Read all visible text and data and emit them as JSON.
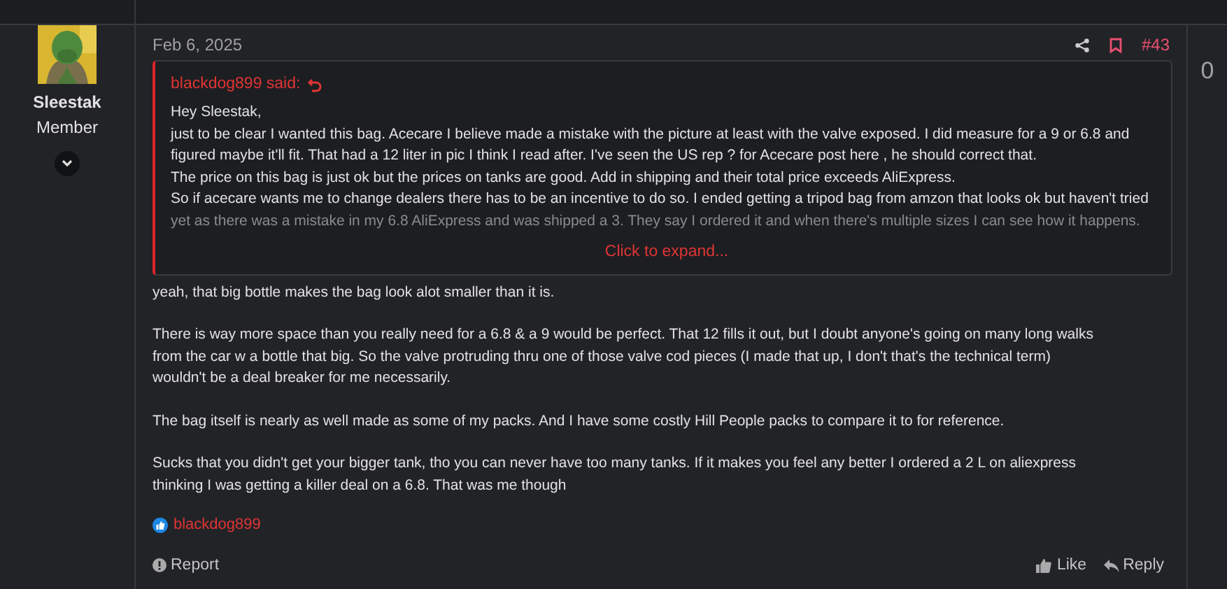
{
  "author": {
    "name": "Sleestak",
    "role": "Member"
  },
  "post": {
    "date": "Feb 6, 2025",
    "number": "#43",
    "bookmarked": false
  },
  "quote": {
    "attribution": "blackdog899 said:",
    "collapsed": true,
    "lines": [
      "Hey Sleestak,",
      "just to be clear I wanted this bag. Acecare I believe made a mistake with the picture at least with the valve exposed. I did measure for a 9 or 6.8 and",
      "figured maybe it'll fit. That had a 12 liter in pic I think I read after. I've seen the US rep ? for Acecare post here , he should correct that.",
      "The price on this bag is just ok but the prices on tanks are good. Add in shipping and their total price exceeds AliExpress.",
      "So if acecare wants me to change dealers there has to be an incentive to do so. I ended getting a tripod bag from amzon that looks ok but haven't tried",
      "yet as there was a mistake in my 6.8 AliExpress and was shipped a 3. They say I ordered it and when there's multiple sizes I can see how it happens."
    ],
    "expand": "Click to expand..."
  },
  "paragraphs": [
    [
      "yeah, that big bottle makes the bag look alot smaller than it is."
    ],
    [
      "There is way more space than you really need for a 6.8 & a 9 would be perfect. That 12 fills it out, but I doubt anyone's going on many long walks",
      "from the car w a bottle that big. So the valve protruding thru one of those valve cod pieces (I made that up, I don't that's the technical term)",
      "wouldn't be a deal breaker for me necessarily."
    ],
    [
      "The bag itself is nearly as well made as some of my packs. And I have some costly Hill People packs to compare it to for reference."
    ],
    [
      "Sucks that you didn't get your bigger tank, tho you can never have too many tanks. If it makes you feel any better I ordered a 2 L on aliexpress",
      "thinking I was getting a killer deal on a 6.8. That was me though"
    ]
  ],
  "reactions": {
    "users": "blackdog899"
  },
  "actions": {
    "report": "Report",
    "like": "Like",
    "reply": "Reply"
  },
  "score": "0"
}
